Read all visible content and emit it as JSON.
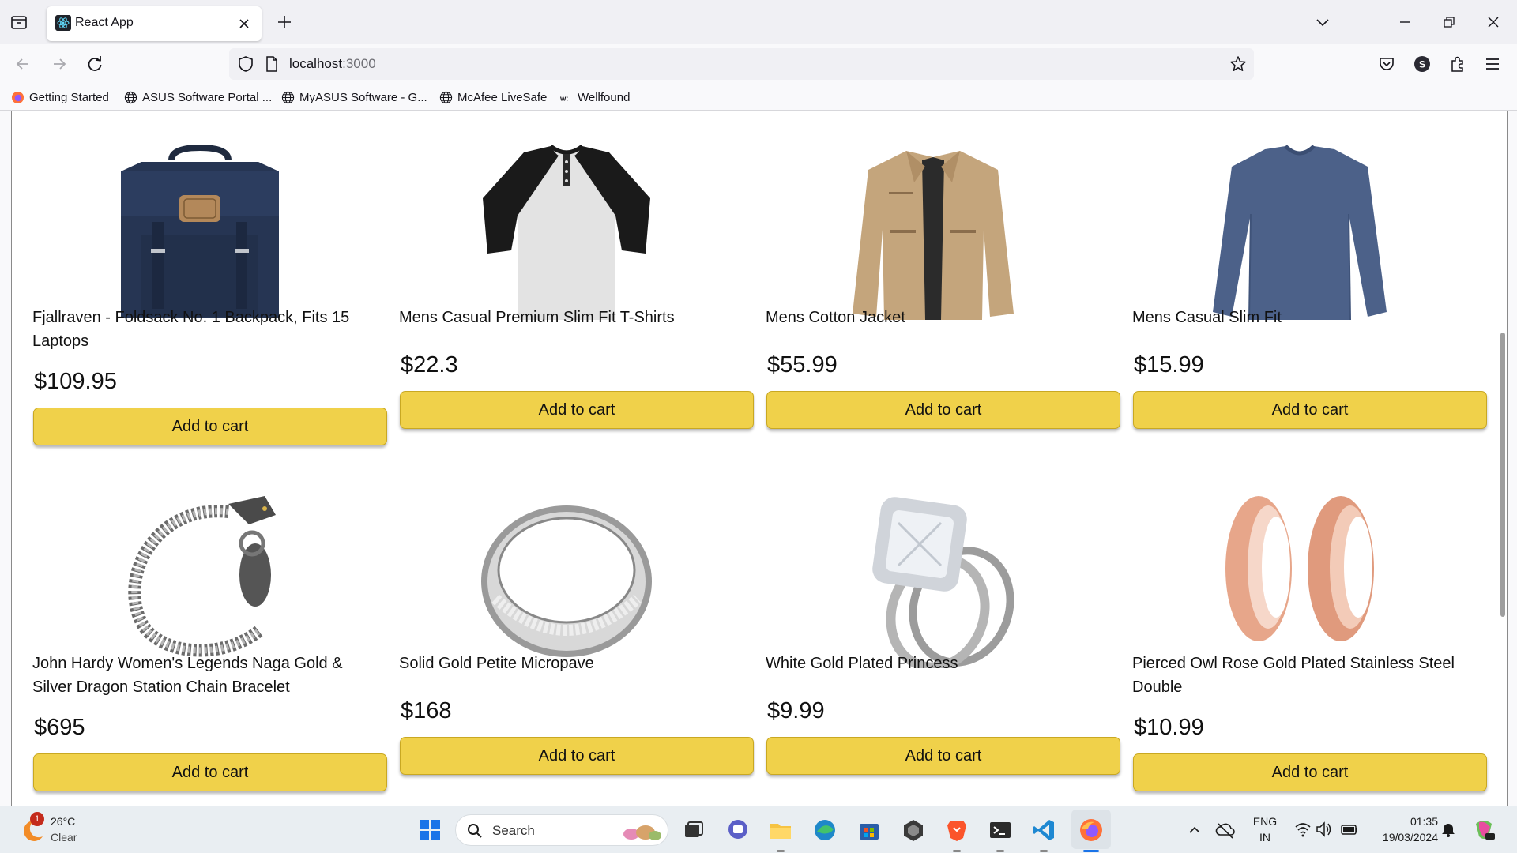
{
  "browser": {
    "tab_title": "React App",
    "url_host": "localhost",
    "url_port": ":3000",
    "bookmarks": [
      {
        "label": "Getting Started",
        "icon": "firefox-icon"
      },
      {
        "label": "ASUS Software Portal ...",
        "icon": "globe-icon"
      },
      {
        "label": "MyASUS Software - G...",
        "icon": "globe-icon"
      },
      {
        "label": "McAfee LiveSafe",
        "icon": "globe-icon"
      },
      {
        "label": "Wellfound",
        "icon": "wellfound-icon"
      }
    ],
    "profile_initial": "S"
  },
  "products": [
    {
      "title": "Fjallraven - Foldsack No. 1 Backpack, Fits 15 Laptops",
      "price": "$109.95",
      "button": "Add to cart",
      "image": "backpack"
    },
    {
      "title": "Mens Casual Premium Slim Fit T-Shirts",
      "price": "$22.3",
      "button": "Add to cart",
      "image": "tshirt"
    },
    {
      "title": "Mens Cotton Jacket",
      "price": "$55.99",
      "button": "Add to cart",
      "image": "jacket"
    },
    {
      "title": "Mens Casual Slim Fit",
      "price": "$15.99",
      "button": "Add to cart",
      "image": "longsleeve"
    },
    {
      "title": "John Hardy Women's Legends Naga Gold & Silver Dragon Station Chain Bracelet",
      "price": "$695",
      "button": "Add to cart",
      "image": "bracelet"
    },
    {
      "title": "Solid Gold Petite Micropave",
      "price": "$168",
      "button": "Add to cart",
      "image": "silver-ring"
    },
    {
      "title": "White Gold Plated Princess",
      "price": "$9.99",
      "button": "Add to cart",
      "image": "princess-ring"
    },
    {
      "title": "Pierced Owl Rose Gold Plated Stainless Steel Double",
      "price": "$10.99",
      "button": "Add to cart",
      "image": "rose-gold-plugs"
    }
  ],
  "taskbar": {
    "weather_temp": "26°C",
    "weather_desc": "Clear",
    "weather_badge": "1",
    "search_label": "Search",
    "lang_top": "ENG",
    "lang_bottom": "IN",
    "time": "01:35",
    "date": "19/03/2024"
  },
  "colors": {
    "button_yellow": "#f0d14a",
    "taskbar_bg": "#e9eef2"
  }
}
